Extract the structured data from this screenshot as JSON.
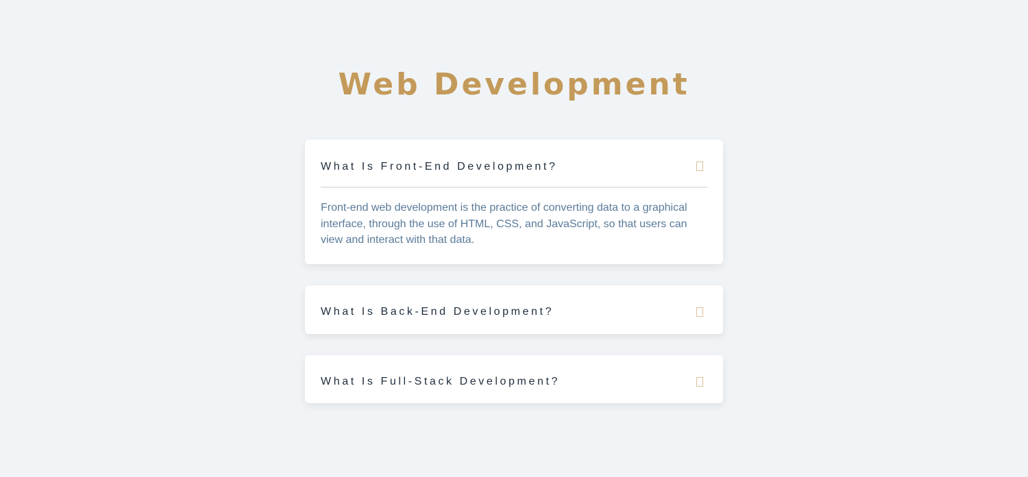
{
  "page": {
    "title": "Web Development"
  },
  "faq": {
    "items": [
      {
        "question": "What Is Front-End Development?",
        "answer": "Front-end web development is the practice of converting data to a graphical interface, through the use of HTML, CSS, and JavaScript, so that users can view and interact with that data.",
        "expanded": true,
        "icon": "toggle-icon"
      },
      {
        "question": "What Is Back-End Development?",
        "expanded": false,
        "icon": "toggle-icon"
      },
      {
        "question": "What Is Full-Stack Development?",
        "expanded": false,
        "icon": "toggle-icon"
      }
    ]
  },
  "colors": {
    "background": "#f1f4f7",
    "title": "#c49a5a",
    "question_text": "#1f2d3d",
    "answer_text": "#5a7a99",
    "card": "#ffffff"
  }
}
